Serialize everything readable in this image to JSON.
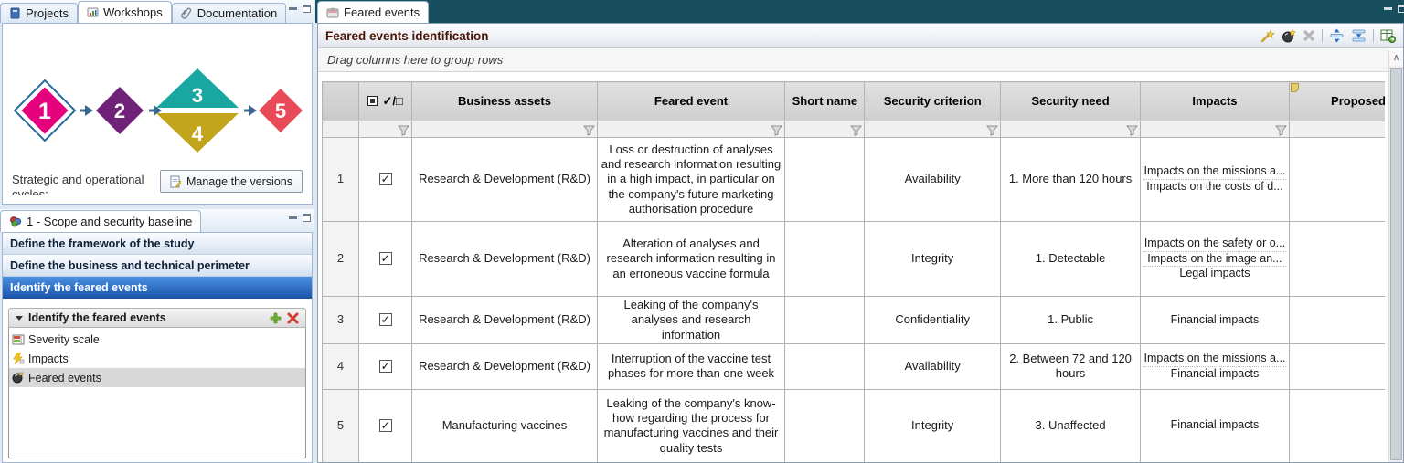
{
  "left_top": {
    "tabs": [
      {
        "label": "Projects"
      },
      {
        "label": "Workshops",
        "active": true
      },
      {
        "label": "Documentation"
      }
    ],
    "diagram": {
      "steps": [
        {
          "n": "1",
          "color": "#e5007d",
          "selected": true
        },
        {
          "n": "2",
          "color": "#6f2277"
        },
        {
          "n": "3",
          "color": "#18a7a1"
        },
        {
          "n": "4",
          "color": "#c3a51d"
        },
        {
          "n": "5",
          "color": "#e84a57"
        }
      ],
      "arrow_color": "#38678f"
    },
    "caption_line1": "Strategic and operational",
    "caption_line2": "cycles:",
    "manage_versions_button": "Manage the versions"
  },
  "left_bottom": {
    "tab": "1 - Scope and security baseline",
    "steps": [
      {
        "label": "Define the framework of the study"
      },
      {
        "label": "Define the business and technical perimeter"
      },
      {
        "label": "Identify the feared events",
        "active": true
      }
    ],
    "subpanel": {
      "title": "Identify the feared events",
      "items": [
        {
          "label": "Severity scale"
        },
        {
          "label": "Impacts"
        },
        {
          "label": "Feared events",
          "selected": true
        }
      ]
    }
  },
  "main": {
    "tab": "Feared events",
    "panel_title": "Feared events identification",
    "group_bar_hint": "Drag columns here to group rows",
    "accent_teal": "#174f5e",
    "active_step_blue": "#2e6fd0",
    "table": {
      "select_all_header": "✓/□",
      "headers": [
        "Business assets",
        "Feared event",
        "Short name",
        "Security criterion",
        "Security need",
        "Impacts",
        "Proposed"
      ],
      "rows": [
        {
          "num": "1",
          "checked": true,
          "business_asset": "Research & Development (R&D)",
          "feared_event": "Loss or destruction of analyses and research information resulting in a high impact, in particular on the company's future marketing authorisation procedure",
          "short_name": "",
          "security_criterion": "Availability",
          "security_need": "1. More than 120 hours",
          "impacts": [
            "Impacts on the missions a...",
            "Impacts on the costs of d..."
          ]
        },
        {
          "num": "2",
          "checked": true,
          "business_asset": "Research & Development (R&D)",
          "feared_event": "Alteration of analyses and research information resulting in an erroneous vaccine formula",
          "short_name": "",
          "security_criterion": "Integrity",
          "security_need": "1. Detectable",
          "impacts": [
            "Impacts on the safety or o...",
            "Impacts on the image an...",
            "Legal impacts"
          ]
        },
        {
          "num": "3",
          "checked": true,
          "business_asset": "Research & Development (R&D)",
          "feared_event": "Leaking of the company's analyses and research information",
          "short_name": "",
          "security_criterion": "Confidentiality",
          "security_need": "1. Public",
          "impacts": [
            "Financial impacts"
          ]
        },
        {
          "num": "4",
          "checked": true,
          "business_asset": "Research & Development (R&D)",
          "feared_event": "Interruption of the vaccine test phases for more than one week",
          "short_name": "",
          "security_criterion": "Availability",
          "security_need": "2. Between 72 and 120 hours",
          "impacts": [
            "Impacts on the missions a...",
            "Financial impacts"
          ]
        },
        {
          "num": "5",
          "checked": true,
          "business_asset": "Manufacturing vaccines",
          "feared_event": "Leaking of the company's know-how regarding the process for manufacturing vaccines and their quality tests",
          "short_name": "",
          "security_criterion": "Integrity",
          "security_need": "3. Unaffected",
          "impacts": [
            "Financial impacts"
          ]
        }
      ]
    }
  }
}
